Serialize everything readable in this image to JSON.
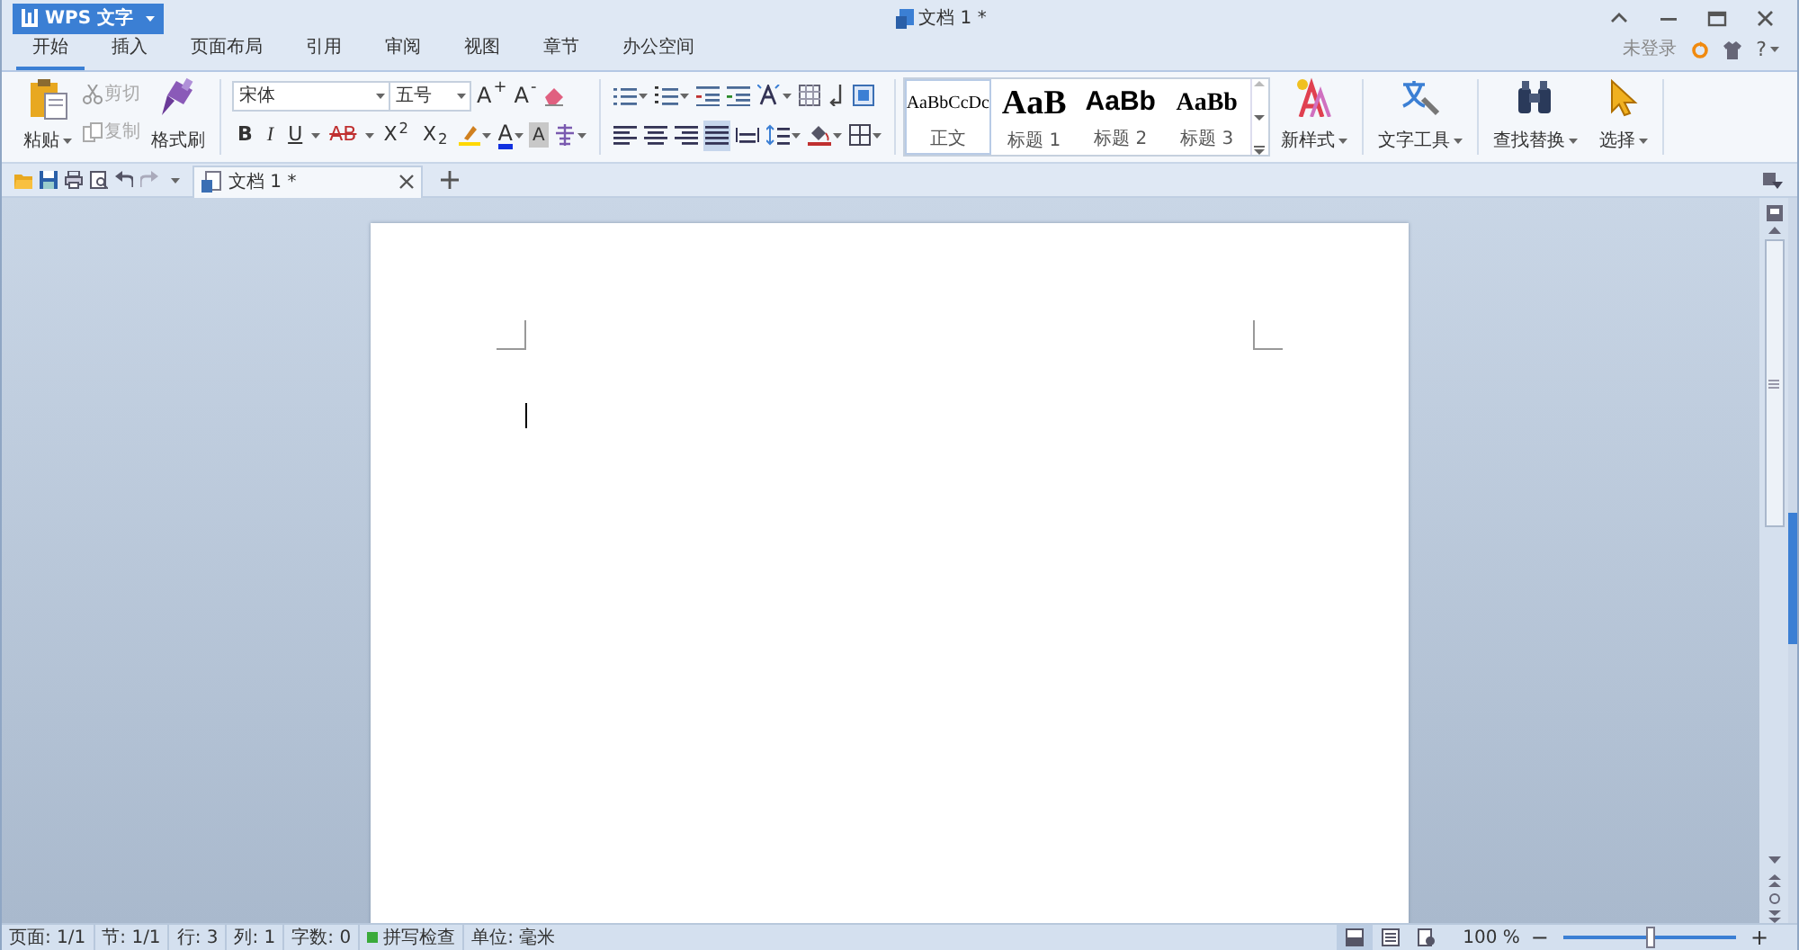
{
  "app_button": {
    "label": "WPS 文字"
  },
  "window": {
    "title": "文档 1 *"
  },
  "menu_tabs": [
    {
      "label": "开始",
      "selected": true
    },
    {
      "label": "插入",
      "selected": false
    },
    {
      "label": "页面布局",
      "selected": false
    },
    {
      "label": "引用",
      "selected": false
    },
    {
      "label": "审阅",
      "selected": false
    },
    {
      "label": "视图",
      "selected": false
    },
    {
      "label": "章节",
      "selected": false
    },
    {
      "label": "办公空间",
      "selected": false
    }
  ],
  "account": {
    "login_status": "未登录",
    "help": "?"
  },
  "clipboard": {
    "paste": "粘贴",
    "cut": {
      "label": "剪切",
      "disabled": true
    },
    "copy": {
      "label": "复制",
      "disabled": true
    },
    "format_painter": "格式刷"
  },
  "font": {
    "family": "宋体",
    "size": "五号",
    "grow": "A$^{+}$",
    "shrink": "A$^{-}$",
    "styles": [
      {
        "kind": "bold",
        "label": "B"
      },
      {
        "kind": "italic",
        "label": "I"
      },
      {
        "kind": "underline",
        "label": "U"
      },
      {
        "kind": "strike",
        "label": "AB"
      },
      {
        "kind": "plain",
        "label": "X$^{2}$"
      },
      {
        "kind": "plain",
        "label": "X$_{2}$"
      }
    ],
    "font_color": "A",
    "char_shading": "A"
  },
  "paragraph": {
    "alignments": [
      {
        "kind": "left",
        "selected": false
      },
      {
        "kind": "center",
        "selected": false
      },
      {
        "kind": "right",
        "selected": false
      },
      {
        "kind": "justify",
        "selected": true
      },
      {
        "kind": "distributed",
        "selected": false
      }
    ]
  },
  "styles_gallery": [
    {
      "kind": "body",
      "preview": "AaBbCcDc",
      "label": "正文",
      "selected": true
    },
    {
      "kind": "heading1",
      "preview": "AaB",
      "label": "标题 1",
      "selected": false
    },
    {
      "kind": "heading2",
      "preview": "AaBb",
      "label": "标题 2",
      "selected": false
    },
    {
      "kind": "heading3",
      "preview": "AaBb",
      "label": "标题 3",
      "selected": false
    }
  ],
  "big_buttons": [
    {
      "kind": "new_style",
      "label": "新样式"
    },
    {
      "kind": "text_tools",
      "label": "文字工具"
    },
    {
      "kind": "find_replace",
      "label": "查找替换"
    },
    {
      "kind": "select",
      "label": "选择"
    }
  ],
  "doc_tabs": [
    {
      "label": "文档 1 *",
      "selected": true
    }
  ],
  "status_bar": {
    "fields": [
      "页面: 1/1",
      "节: 1/1",
      "行: 3",
      "列: 1",
      "字数: 0"
    ],
    "spell_check": "拼写检查",
    "unit": "单位: 毫米",
    "view_modes": [
      {
        "kind": "page",
        "selected": true
      },
      {
        "kind": "outline",
        "selected": false
      },
      {
        "kind": "web",
        "selected": false
      }
    ],
    "zoom": "100 %",
    "zoom_out": "−",
    "zoom_in": "+",
    "zoom_slider": {
      "level": 0.5
    }
  }
}
